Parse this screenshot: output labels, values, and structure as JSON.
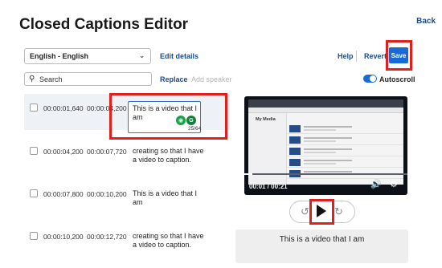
{
  "header": {
    "title": "Closed Captions Editor",
    "back_label": "Back"
  },
  "toolbar": {
    "language_value": "English - English",
    "edit_details_label": "Edit details",
    "help_label": "Help",
    "revert_label": "Revert",
    "save_label": "Save"
  },
  "search": {
    "placeholder": "Search",
    "replace_label": "Replace",
    "add_speaker_label": "Add speaker"
  },
  "autoscroll": {
    "label": "Autoscroll",
    "enabled": true
  },
  "captions": [
    {
      "start": "00:00:01,640",
      "end": "00:00:04,200",
      "text": "This is a video that I am",
      "char_count": "25/64",
      "editing": true
    },
    {
      "start": "00:00:04,200",
      "end": "00:00:07,720",
      "text": "creating so that I have a video to caption.",
      "editing": false
    },
    {
      "start": "00:00:07,800",
      "end": "00:00:10,200",
      "text": "This is a video that I am",
      "editing": false
    },
    {
      "start": "00:00:10,200",
      "end": "00:00:12,720",
      "text": "creating so that I have a video to caption.",
      "editing": false
    }
  ],
  "player": {
    "time_display": "00:01 / 00:21",
    "progress_fraction": 0.05,
    "screen_heading": "My Media",
    "current_caption": "This is a video that I am"
  },
  "colors": {
    "accent": "#1a6ad6",
    "link": "#1a4b8c",
    "highlight": "#e0201c"
  },
  "icons": [
    "search-icon",
    "chevron-down-icon",
    "volume-icon",
    "settings-icon",
    "rewind-icon",
    "play-icon",
    "forward-icon"
  ]
}
